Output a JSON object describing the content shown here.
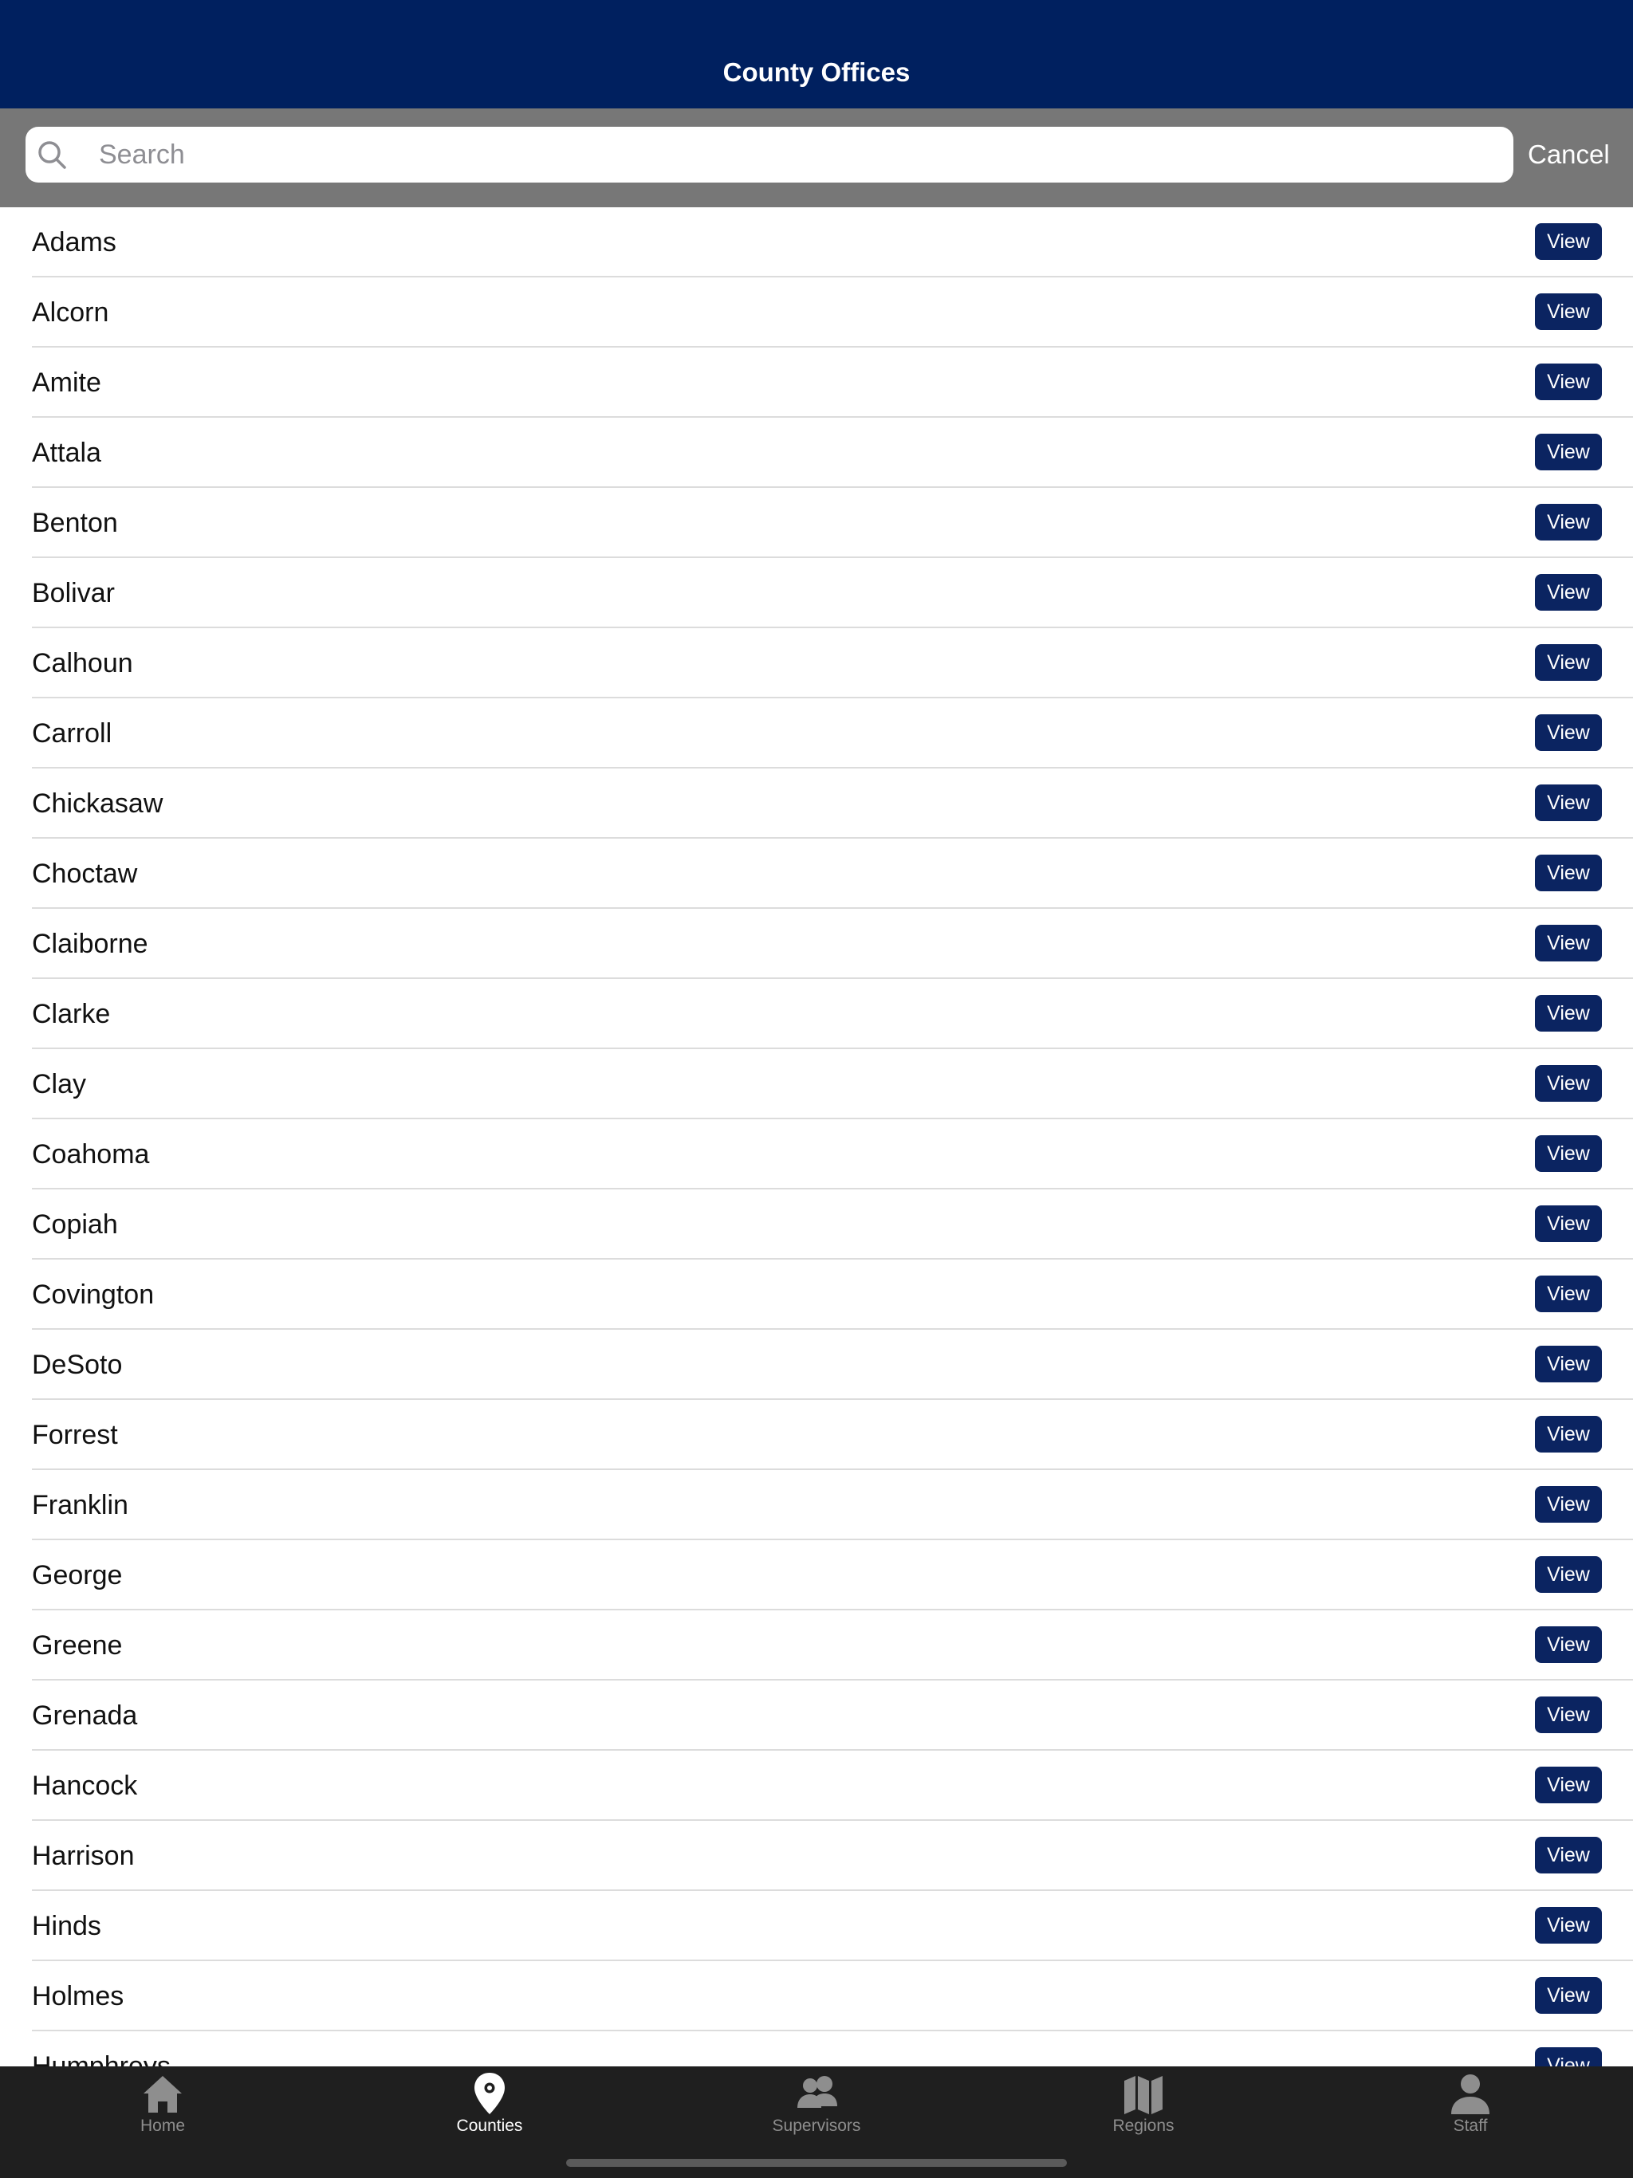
{
  "header": {
    "title": "County Offices"
  },
  "search": {
    "placeholder": "Search",
    "value": "",
    "cancel_label": "Cancel"
  },
  "list": {
    "button_label": "View",
    "items": [
      "Adams",
      "Alcorn",
      "Amite",
      "Attala",
      "Benton",
      "Bolivar",
      "Calhoun",
      "Carroll",
      "Chickasaw",
      "Choctaw",
      "Claiborne",
      "Clarke",
      "Clay",
      "Coahoma",
      "Copiah",
      "Covington",
      "DeSoto",
      "Forrest",
      "Franklin",
      "George",
      "Greene",
      "Grenada",
      "Hancock",
      "Harrison",
      "Hinds",
      "Holmes",
      "Humphreys"
    ]
  },
  "tabbar": {
    "active": "Counties",
    "tabs": [
      {
        "label": "Home",
        "icon": "house-icon"
      },
      {
        "label": "Counties",
        "icon": "map-pin-icon"
      },
      {
        "label": "Supervisors",
        "icon": "people-icon"
      },
      {
        "label": "Regions",
        "icon": "map-icon"
      },
      {
        "label": "Staff",
        "icon": "person-icon"
      }
    ]
  },
  "colors": {
    "navbar": "#00205f",
    "searchbar": "#777777",
    "button": "#0b2461",
    "tabbar": "#1f1f1f"
  }
}
